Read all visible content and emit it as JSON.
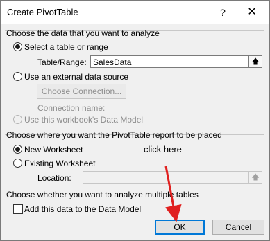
{
  "window": {
    "title": "Create PivotTable",
    "help_label": "?",
    "close_label": "✕"
  },
  "source_section": {
    "heading": "Choose the data that you want to analyze",
    "select_table_label": "Select a table or range",
    "table_range_label": "Table/Range:",
    "table_range_value": "SalesData",
    "external_label": "Use an external data source",
    "choose_connection_label": "Choose Connection...",
    "connection_name_label": "Connection name:",
    "data_model_label": "Use this workbook's Data Model"
  },
  "placement_section": {
    "heading": "Choose where you want the PivotTable report to be placed",
    "new_worksheet_label": "New Worksheet",
    "existing_worksheet_label": "Existing Worksheet",
    "location_label": "Location:",
    "location_value": ""
  },
  "multi_section": {
    "heading": "Choose whether you want to analyze multiple tables",
    "add_data_model_label": "Add this data to the Data Model"
  },
  "buttons": {
    "ok_label": "OK",
    "cancel_label": "Cancel"
  },
  "annotation": {
    "text": "click here",
    "color": "#e0201f"
  },
  "icons": {
    "range_picker": "up-arrow-icon"
  }
}
